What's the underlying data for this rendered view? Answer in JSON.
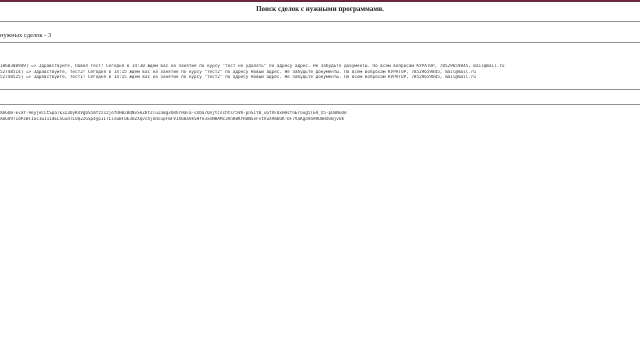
{
  "header": {
    "title": "Поиск сделок с нужными программами."
  },
  "summary": {
    "deals_count_text": "нужных сделок - 3"
  },
  "log_lines": [
    "1860308949] => Здравствуйте, Павел тест! Сегодня в 14:30 ждем вас на занятие по курсу \"тест не удалять\" по адресу адрес. Не забудьте документы. По всем вопросам КУРАТОР, 78529659845, mail@mail.ru",
    "52748514] => Здравствуйте, тест2! Сегодня в 14:15 ждем вас на занятие по курсу \"тест2\" по адресу Новый адрес. Не забудьте документы. По всем вопросам КУРАТОР, 78529659845, mail@mail.ru",
    "52748525] => Здравствуйте, тест1! Сегодня в 14:15 ждем вас на занятие по курсу \"тест2\" по адресу Новый адрес. Не забудьте документы. По всем вопросам КУРАТОР, 78529659845, mail@mail.ru"
  ],
  "token_lines": [
    "XmGUB-EvaY-9eyjeCCtSpaTk323DyKXVgbS5mfzz1zjofOH02BQNvSkZKYZTuIa0g3hRhrHaFa-sXba7Qnjtcschtsr5VK-pnSiYB_uGfVFOxHHsfnEroug5TER_X5-pUoNuOk",
    "XmGU9T1dPZBFIoc1w111dELSGudTLUQ22GSp4yp1ITLiswBFOE3UZXqvchjOdsupFmFV1Xb8aVkSHfe3xoNHAMc3VnK8KYRmNSvFsthuX9mbOK-bF7VaKgo9a9ROmRdvBjvOk"
  ]
}
